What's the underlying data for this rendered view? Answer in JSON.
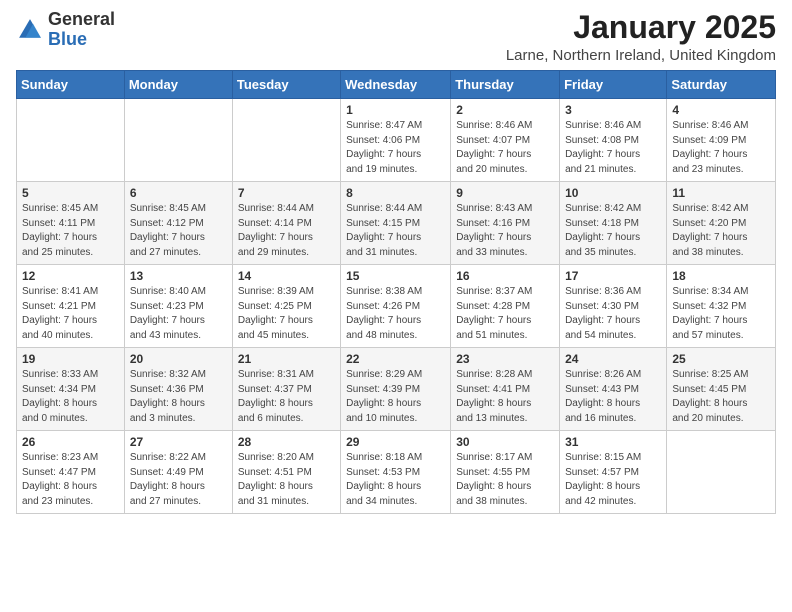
{
  "logo": {
    "general": "General",
    "blue": "Blue"
  },
  "header": {
    "month_title": "January 2025",
    "location": "Larne, Northern Ireland, United Kingdom"
  },
  "weekdays": [
    "Sunday",
    "Monday",
    "Tuesday",
    "Wednesday",
    "Thursday",
    "Friday",
    "Saturday"
  ],
  "weeks": [
    [
      {
        "day": "",
        "info": ""
      },
      {
        "day": "",
        "info": ""
      },
      {
        "day": "",
        "info": ""
      },
      {
        "day": "1",
        "info": "Sunrise: 8:47 AM\nSunset: 4:06 PM\nDaylight: 7 hours\nand 19 minutes."
      },
      {
        "day": "2",
        "info": "Sunrise: 8:46 AM\nSunset: 4:07 PM\nDaylight: 7 hours\nand 20 minutes."
      },
      {
        "day": "3",
        "info": "Sunrise: 8:46 AM\nSunset: 4:08 PM\nDaylight: 7 hours\nand 21 minutes."
      },
      {
        "day": "4",
        "info": "Sunrise: 8:46 AM\nSunset: 4:09 PM\nDaylight: 7 hours\nand 23 minutes."
      }
    ],
    [
      {
        "day": "5",
        "info": "Sunrise: 8:45 AM\nSunset: 4:11 PM\nDaylight: 7 hours\nand 25 minutes."
      },
      {
        "day": "6",
        "info": "Sunrise: 8:45 AM\nSunset: 4:12 PM\nDaylight: 7 hours\nand 27 minutes."
      },
      {
        "day": "7",
        "info": "Sunrise: 8:44 AM\nSunset: 4:14 PM\nDaylight: 7 hours\nand 29 minutes."
      },
      {
        "day": "8",
        "info": "Sunrise: 8:44 AM\nSunset: 4:15 PM\nDaylight: 7 hours\nand 31 minutes."
      },
      {
        "day": "9",
        "info": "Sunrise: 8:43 AM\nSunset: 4:16 PM\nDaylight: 7 hours\nand 33 minutes."
      },
      {
        "day": "10",
        "info": "Sunrise: 8:42 AM\nSunset: 4:18 PM\nDaylight: 7 hours\nand 35 minutes."
      },
      {
        "day": "11",
        "info": "Sunrise: 8:42 AM\nSunset: 4:20 PM\nDaylight: 7 hours\nand 38 minutes."
      }
    ],
    [
      {
        "day": "12",
        "info": "Sunrise: 8:41 AM\nSunset: 4:21 PM\nDaylight: 7 hours\nand 40 minutes."
      },
      {
        "day": "13",
        "info": "Sunrise: 8:40 AM\nSunset: 4:23 PM\nDaylight: 7 hours\nand 43 minutes."
      },
      {
        "day": "14",
        "info": "Sunrise: 8:39 AM\nSunset: 4:25 PM\nDaylight: 7 hours\nand 45 minutes."
      },
      {
        "day": "15",
        "info": "Sunrise: 8:38 AM\nSunset: 4:26 PM\nDaylight: 7 hours\nand 48 minutes."
      },
      {
        "day": "16",
        "info": "Sunrise: 8:37 AM\nSunset: 4:28 PM\nDaylight: 7 hours\nand 51 minutes."
      },
      {
        "day": "17",
        "info": "Sunrise: 8:36 AM\nSunset: 4:30 PM\nDaylight: 7 hours\nand 54 minutes."
      },
      {
        "day": "18",
        "info": "Sunrise: 8:34 AM\nSunset: 4:32 PM\nDaylight: 7 hours\nand 57 minutes."
      }
    ],
    [
      {
        "day": "19",
        "info": "Sunrise: 8:33 AM\nSunset: 4:34 PM\nDaylight: 8 hours\nand 0 minutes."
      },
      {
        "day": "20",
        "info": "Sunrise: 8:32 AM\nSunset: 4:36 PM\nDaylight: 8 hours\nand 3 minutes."
      },
      {
        "day": "21",
        "info": "Sunrise: 8:31 AM\nSunset: 4:37 PM\nDaylight: 8 hours\nand 6 minutes."
      },
      {
        "day": "22",
        "info": "Sunrise: 8:29 AM\nSunset: 4:39 PM\nDaylight: 8 hours\nand 10 minutes."
      },
      {
        "day": "23",
        "info": "Sunrise: 8:28 AM\nSunset: 4:41 PM\nDaylight: 8 hours\nand 13 minutes."
      },
      {
        "day": "24",
        "info": "Sunrise: 8:26 AM\nSunset: 4:43 PM\nDaylight: 8 hours\nand 16 minutes."
      },
      {
        "day": "25",
        "info": "Sunrise: 8:25 AM\nSunset: 4:45 PM\nDaylight: 8 hours\nand 20 minutes."
      }
    ],
    [
      {
        "day": "26",
        "info": "Sunrise: 8:23 AM\nSunset: 4:47 PM\nDaylight: 8 hours\nand 23 minutes."
      },
      {
        "day": "27",
        "info": "Sunrise: 8:22 AM\nSunset: 4:49 PM\nDaylight: 8 hours\nand 27 minutes."
      },
      {
        "day": "28",
        "info": "Sunrise: 8:20 AM\nSunset: 4:51 PM\nDaylight: 8 hours\nand 31 minutes."
      },
      {
        "day": "29",
        "info": "Sunrise: 8:18 AM\nSunset: 4:53 PM\nDaylight: 8 hours\nand 34 minutes."
      },
      {
        "day": "30",
        "info": "Sunrise: 8:17 AM\nSunset: 4:55 PM\nDaylight: 8 hours\nand 38 minutes."
      },
      {
        "day": "31",
        "info": "Sunrise: 8:15 AM\nSunset: 4:57 PM\nDaylight: 8 hours\nand 42 minutes."
      },
      {
        "day": "",
        "info": ""
      }
    ]
  ]
}
